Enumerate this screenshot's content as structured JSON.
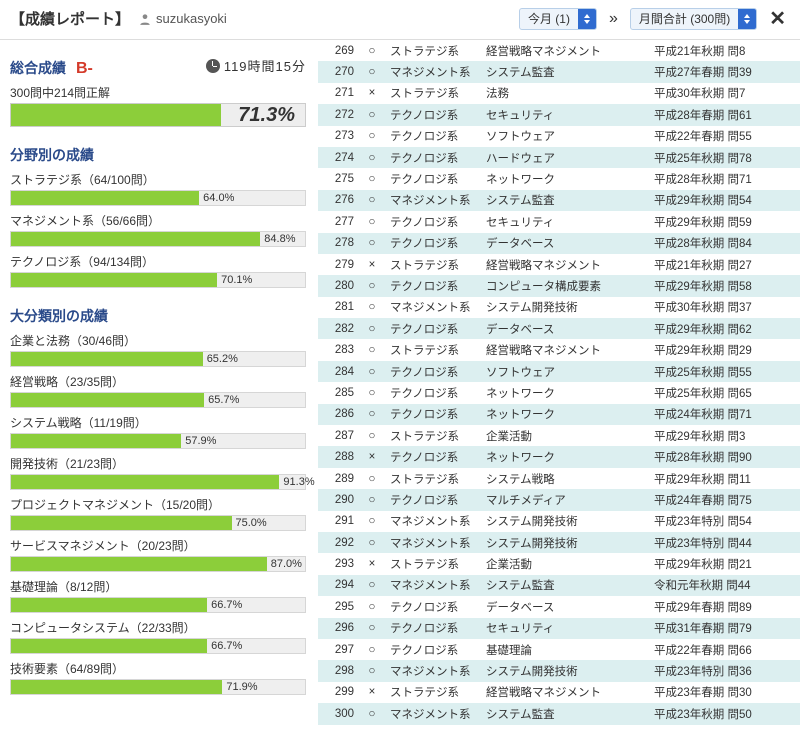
{
  "header": {
    "title": "【成績レポート】",
    "username": "suzukasyoki",
    "select1": "今月 (1)",
    "select2": "月間合計 (300問)"
  },
  "overall": {
    "title": "総合成績",
    "grade": "B-",
    "time": "119時間15分",
    "summary": "300問中214問正解",
    "pct": 71.3
  },
  "byField": {
    "title": "分野別の成績",
    "items": [
      {
        "label": "ストラテジ系（64/100問）",
        "pct": 64.0
      },
      {
        "label": "マネジメント系（56/66問）",
        "pct": 84.8
      },
      {
        "label": "テクノロジ系（94/134問）",
        "pct": 70.1
      }
    ]
  },
  "byMajor": {
    "title": "大分類別の成績",
    "items": [
      {
        "label": "企業と法務（30/46問）",
        "pct": 65.2
      },
      {
        "label": "経営戦略（23/35問）",
        "pct": 65.7
      },
      {
        "label": "システム戦略（11/19問）",
        "pct": 57.9
      },
      {
        "label": "開発技術（21/23問）",
        "pct": 91.3
      },
      {
        "label": "プロジェクトマネジメント（15/20問）",
        "pct": 75.0
      },
      {
        "label": "サービスマネジメント（20/23問）",
        "pct": 87.0
      },
      {
        "label": "基礎理論（8/12問）",
        "pct": 66.7
      },
      {
        "label": "コンピュータシステム（22/33問）",
        "pct": 66.7
      },
      {
        "label": "技術要素（64/89問）",
        "pct": 71.9
      }
    ]
  },
  "questions": [
    {
      "n": 269,
      "ok": true,
      "cat": "ストラテジ系",
      "sub": "経営戦略マネジメント",
      "src": "平成21年秋期 問8"
    },
    {
      "n": 270,
      "ok": true,
      "cat": "マネジメント系",
      "sub": "システム監査",
      "src": "平成27年春期 問39"
    },
    {
      "n": 271,
      "ok": false,
      "cat": "ストラテジ系",
      "sub": "法務",
      "src": "平成30年秋期 問7"
    },
    {
      "n": 272,
      "ok": true,
      "cat": "テクノロジ系",
      "sub": "セキュリティ",
      "src": "平成28年春期 問61"
    },
    {
      "n": 273,
      "ok": true,
      "cat": "テクノロジ系",
      "sub": "ソフトウェア",
      "src": "平成22年春期 問55"
    },
    {
      "n": 274,
      "ok": true,
      "cat": "テクノロジ系",
      "sub": "ハードウェア",
      "src": "平成25年秋期 問78"
    },
    {
      "n": 275,
      "ok": true,
      "cat": "テクノロジ系",
      "sub": "ネットワーク",
      "src": "平成28年秋期 問71"
    },
    {
      "n": 276,
      "ok": true,
      "cat": "マネジメント系",
      "sub": "システム監査",
      "src": "平成29年秋期 問54"
    },
    {
      "n": 277,
      "ok": true,
      "cat": "テクノロジ系",
      "sub": "セキュリティ",
      "src": "平成29年秋期 問59"
    },
    {
      "n": 278,
      "ok": true,
      "cat": "テクノロジ系",
      "sub": "データベース",
      "src": "平成28年秋期 問84"
    },
    {
      "n": 279,
      "ok": false,
      "cat": "ストラテジ系",
      "sub": "経営戦略マネジメント",
      "src": "平成21年秋期 問27"
    },
    {
      "n": 280,
      "ok": true,
      "cat": "テクノロジ系",
      "sub": "コンピュータ構成要素",
      "src": "平成29年秋期 問58"
    },
    {
      "n": 281,
      "ok": true,
      "cat": "マネジメント系",
      "sub": "システム開発技術",
      "src": "平成30年秋期 問37"
    },
    {
      "n": 282,
      "ok": true,
      "cat": "テクノロジ系",
      "sub": "データベース",
      "src": "平成29年秋期 問62"
    },
    {
      "n": 283,
      "ok": true,
      "cat": "ストラテジ系",
      "sub": "経営戦略マネジメント",
      "src": "平成29年秋期 問29"
    },
    {
      "n": 284,
      "ok": true,
      "cat": "テクノロジ系",
      "sub": "ソフトウェア",
      "src": "平成25年秋期 問55"
    },
    {
      "n": 285,
      "ok": true,
      "cat": "テクノロジ系",
      "sub": "ネットワーク",
      "src": "平成25年秋期 問65"
    },
    {
      "n": 286,
      "ok": true,
      "cat": "テクノロジ系",
      "sub": "ネットワーク",
      "src": "平成24年秋期 問71"
    },
    {
      "n": 287,
      "ok": true,
      "cat": "ストラテジ系",
      "sub": "企業活動",
      "src": "平成29年秋期 問3"
    },
    {
      "n": 288,
      "ok": false,
      "cat": "テクノロジ系",
      "sub": "ネットワーク",
      "src": "平成28年秋期 問90"
    },
    {
      "n": 289,
      "ok": true,
      "cat": "ストラテジ系",
      "sub": "システム戦略",
      "src": "平成29年秋期 問11"
    },
    {
      "n": 290,
      "ok": true,
      "cat": "テクノロジ系",
      "sub": "マルチメディア",
      "src": "平成24年春期 問75"
    },
    {
      "n": 291,
      "ok": true,
      "cat": "マネジメント系",
      "sub": "システム開発技術",
      "src": "平成23年特別 問54"
    },
    {
      "n": 292,
      "ok": true,
      "cat": "マネジメント系",
      "sub": "システム開発技術",
      "src": "平成23年特別 問44"
    },
    {
      "n": 293,
      "ok": false,
      "cat": "ストラテジ系",
      "sub": "企業活動",
      "src": "平成29年秋期 問21"
    },
    {
      "n": 294,
      "ok": true,
      "cat": "マネジメント系",
      "sub": "システム監査",
      "src": "令和元年秋期 問44"
    },
    {
      "n": 295,
      "ok": true,
      "cat": "テクノロジ系",
      "sub": "データベース",
      "src": "平成29年春期 問89"
    },
    {
      "n": 296,
      "ok": true,
      "cat": "テクノロジ系",
      "sub": "セキュリティ",
      "src": "平成31年春期 問79"
    },
    {
      "n": 297,
      "ok": true,
      "cat": "テクノロジ系",
      "sub": "基礎理論",
      "src": "平成22年春期 問66"
    },
    {
      "n": 298,
      "ok": true,
      "cat": "マネジメント系",
      "sub": "システム開発技術",
      "src": "平成23年特別 問36"
    },
    {
      "n": 299,
      "ok": false,
      "cat": "ストラテジ系",
      "sub": "経営戦略マネジメント",
      "src": "平成23年春期 問30"
    },
    {
      "n": 300,
      "ok": true,
      "cat": "マネジメント系",
      "sub": "システム監査",
      "src": "平成23年秋期 問50"
    }
  ]
}
